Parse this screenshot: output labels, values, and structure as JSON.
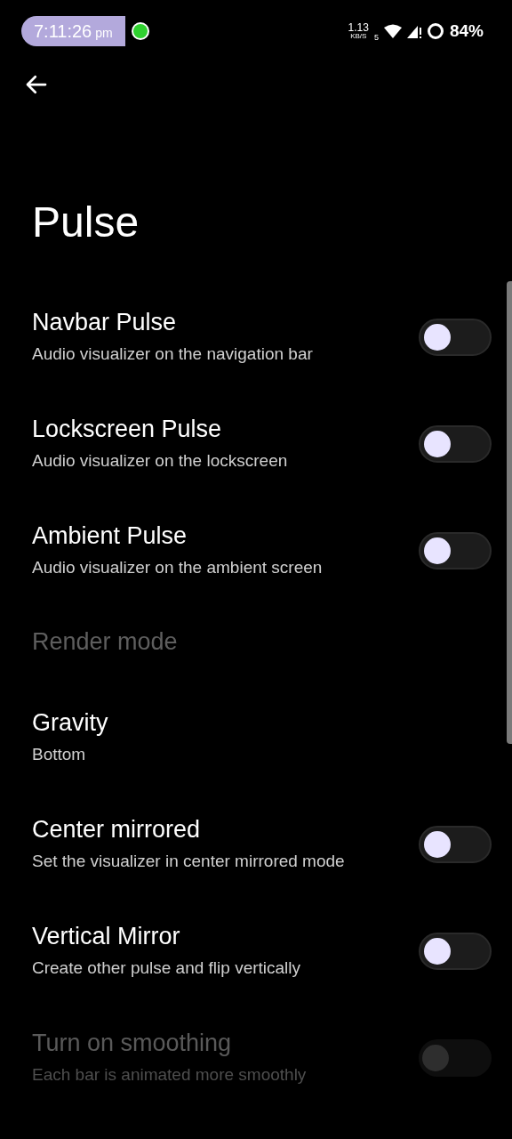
{
  "status_bar": {
    "time": "7:11:26",
    "ampm": "pm",
    "speed_value": "1.13",
    "speed_unit": "KB/S",
    "wifi_badge": "5",
    "battery": "84%"
  },
  "title": "Pulse",
  "items": [
    {
      "kind": "switch",
      "title": "Navbar Pulse",
      "subtitle": "Audio visualizer on the navigation bar",
      "on": false,
      "disabled": false
    },
    {
      "kind": "switch",
      "title": "Lockscreen Pulse",
      "subtitle": "Audio visualizer on the lockscreen",
      "on": false,
      "disabled": false
    },
    {
      "kind": "switch",
      "title": "Ambient Pulse",
      "subtitle": "Audio visualizer on the ambient screen",
      "on": false,
      "disabled": false
    },
    {
      "kind": "header",
      "title": "Render mode"
    },
    {
      "kind": "value",
      "title": "Gravity",
      "subtitle": "Bottom"
    },
    {
      "kind": "switch",
      "title": "Center mirrored",
      "subtitle": "Set the visualizer in center mirrored mode",
      "on": false,
      "disabled": false
    },
    {
      "kind": "switch",
      "title": "Vertical Mirror",
      "subtitle": "Create other pulse and flip vertically",
      "on": false,
      "disabled": false
    },
    {
      "kind": "switch",
      "title": "Turn on smoothing",
      "subtitle": "Each bar is animated more smoothly",
      "on": false,
      "disabled": true
    }
  ]
}
